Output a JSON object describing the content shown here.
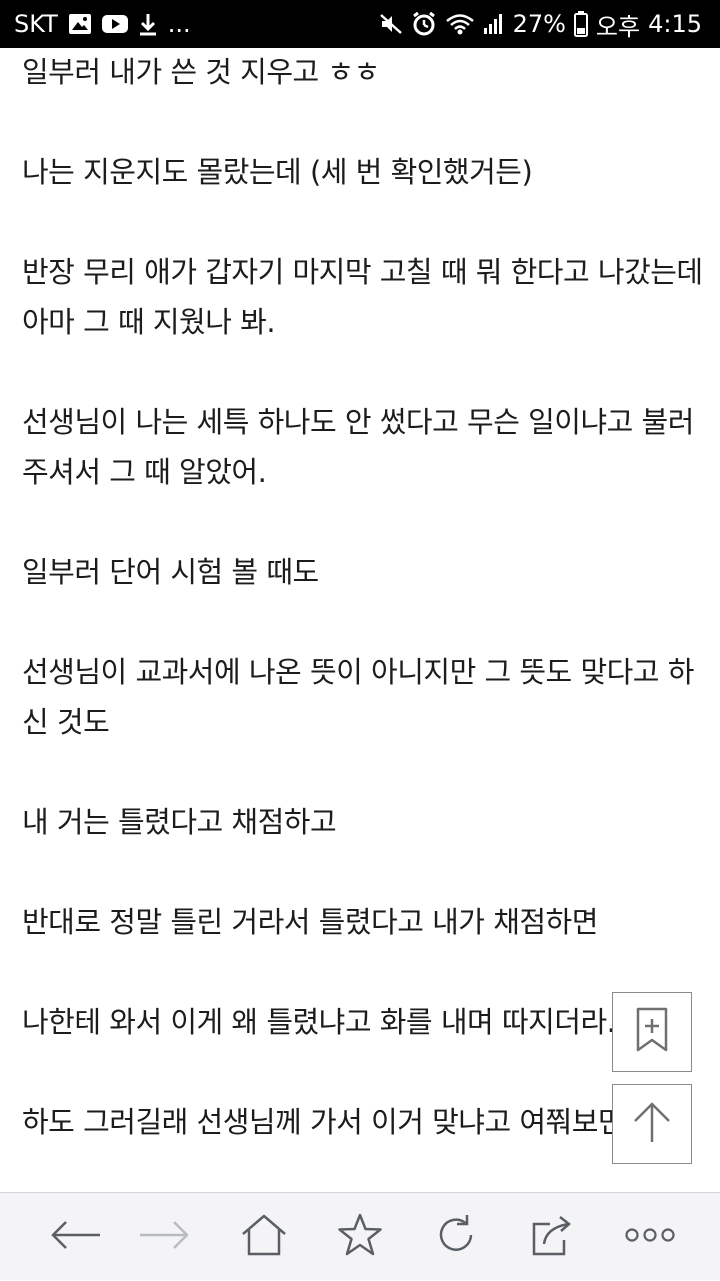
{
  "status_bar": {
    "carrier": "SKT",
    "more": "...",
    "battery_percent": "27%",
    "ampm": "오후",
    "time": "4:15",
    "icons_left": [
      "image-icon",
      "youtube-icon",
      "download-icon"
    ],
    "icons_right": [
      "mute-icon",
      "alarm-icon",
      "wifi-icon",
      "signal-icon",
      "battery-icon"
    ]
  },
  "article": {
    "lines": [
      "일부러 내가 쓴 것 지우고 ㅎㅎ",
      "나는 지운지도 몰랐는데 (세 번 확인했거든)",
      "반장 무리 애가 갑자기 마지막 고칠 때 뭐 한다고 나갔는데",
      "아마 그 때 지웠나 봐.",
      "선생님이 나는 세특 하나도 안 썼다고 무슨 일이냐고 불러",
      "주셔서 그 때 알았어.",
      "일부러 단어 시험 볼 때도",
      "선생님이 교과서에 나온 뜻이 아니지만 그 뜻도 맞다고 하",
      "신 것도",
      "내 거는 틀렸다고 채점하고",
      "반대로 정말 틀린 거라서 틀렸다고 내가 채점하면",
      "나한테 와서 이게 왜 틀렸냐고 화를 내며 따지더라.",
      "하도 그러길래 선생님께 가서 이거 맞냐고 여쭤보면"
    ]
  },
  "floating": {
    "bookmark_add": "bookmark-add-icon",
    "scroll_top": "arrow-up-icon"
  },
  "bottom_nav": {
    "items": [
      "back-arrow-icon",
      "forward-arrow-icon",
      "home-icon",
      "star-icon",
      "refresh-icon",
      "share-icon",
      "more-icon"
    ]
  },
  "colors": {
    "text": "#1c1c1c",
    "status_bar_bg": "#000000",
    "nav_bg": "#f4f4f6",
    "nav_icon": "#5a5f66",
    "nav_icon_disabled": "#b8bcc2"
  }
}
